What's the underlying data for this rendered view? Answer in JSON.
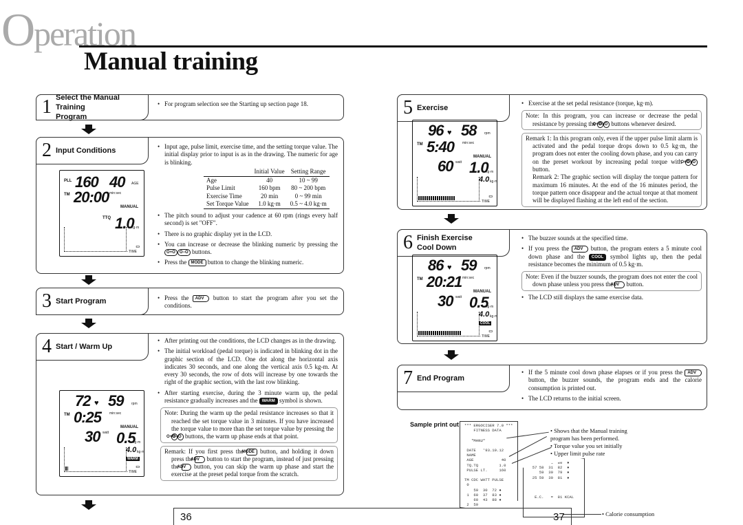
{
  "header": {
    "chapter_first": "O",
    "chapter_rest": "peration",
    "title": "Manual training"
  },
  "sections": {
    "s1": {
      "num": "1",
      "title": [
        "Select the Manual Training",
        "Program"
      ],
      "bullets": [
        [
          {
            "t": "For program selection see the Starting up section page 18."
          }
        ]
      ]
    },
    "s2": {
      "num": "2",
      "title": [
        "Input Conditions"
      ],
      "bullets_top": [
        [
          {
            "t": "Input age, pulse limit, exercise time, and the setting torque value. The initial display prior to input is as in the drawing. The numeric for age is blinking."
          }
        ]
      ],
      "table": {
        "headers": [
          "",
          "Initial Value",
          "Setting Range"
        ],
        "rows": [
          [
            "Age",
            "40",
            "10 ~  99"
          ],
          [
            "Pulse Limit",
            "160 bpm",
            "80 ~ 200 bpm"
          ],
          [
            "Exercise Time",
            "20 min",
            "0 ~  99 min"
          ],
          [
            "Set Torque Value",
            "1.0 kg·m",
            "0.5 ~  4.0 kg·m"
          ]
        ]
      },
      "bullets": [
        [
          {
            "t": "The pitch sound to adjust your cadence at 60 rpm (rings every half second) is set \"OFF\"."
          }
        ],
        [
          {
            "t": "There is no graphic display yet in the LCD."
          }
        ],
        [
          {
            "t": "You can increase or decrease the blinking numeric by pressing the "
          },
          {
            "btn": "plus"
          },
          {
            "btn": "minus"
          },
          {
            "t": " buttons."
          }
        ],
        [
          {
            "t": "Press the "
          },
          {
            "btn": "mode"
          },
          {
            "t": " button to change the blinking numeric."
          }
        ]
      ],
      "lcd": {
        "tl_label": "PLL",
        "a": "160",
        "b": "40",
        "b_unit": "AGE",
        "tm_label": "TM",
        "time": "20:00",
        "time_unit": "min:sec",
        "mode_label": "MANUAL",
        "d_label": "TTQ",
        "d": "1.0",
        "d_unit": "kg·m",
        "axis_label": "TIME"
      }
    },
    "s3": {
      "num": "3",
      "title": [
        "Start Program"
      ],
      "bullets": [
        [
          {
            "t": "Press the "
          },
          {
            "btn": "adv"
          },
          {
            "t": " button to start the program after you set the conditions."
          }
        ]
      ]
    },
    "s4": {
      "num": "4",
      "title": [
        "Start / Warm Up"
      ],
      "bullets": [
        [
          {
            "t": "After printing out the conditions, the LCD changes as in the drawing."
          }
        ],
        [
          {
            "t": "The initial workload (pedal torque) is indicated in blinking dot in the graphic section of the LCD. One dot along the horizontal axis indicates 30 seconds, and one along the vertical axis 0.5 kg-m. At every 30 seconds, the row of dots will increase by one towards the right of the graphic section, with the last row blinking."
          }
        ],
        [
          {
            "t": "After starting exercise, during the 3 minute warm up, the pedal resistance gradually increases and the "
          },
          {
            "btn": "warm"
          },
          {
            "t": " symbol is shown."
          }
        ]
      ],
      "notes": [
        [
          {
            "t": "Note: During the warm up the pedal resistance increases so that it reached the set torque value in 3 minutes. If you have increased the torque value to more than the set torque value by pressing the "
          },
          {
            "btn": "plus"
          },
          {
            "btn": "minus"
          },
          {
            "t": " buttons, the warm up phase ends at that point."
          }
        ],
        [
          {
            "t": "Remark: If you first press the "
          },
          {
            "btn": "mode"
          },
          {
            "t": " button, and holding it down press the "
          },
          {
            "btn": "adv"
          },
          {
            "t": " button to start the program, instead of just pressing the "
          },
          {
            "btn": "adv"
          },
          {
            "t": " button, you can skip the warm up phase and start the exercise at the preset pedal torque from the scratch."
          }
        ]
      ],
      "lcd": {
        "a": "72",
        "heart": "♥",
        "b": "59",
        "b_unit": "rpm",
        "tm_label": "TM",
        "time": "0:25",
        "time_unit": "min:sec",
        "mode_label": "MANUAL",
        "c": "30",
        "c_unit": "watt",
        "d": "0.5",
        "d_unit": "kg·m",
        "e": "4.0",
        "e_unit": "kg·m",
        "badge": "WARM",
        "axis_label": "TIME",
        "bar_fraction": 0.04
      }
    },
    "s5": {
      "num": "5",
      "title": [
        "Exercise"
      ],
      "bullets": [
        [
          {
            "t": "Exercise at the set pedal resistance (torque, kg·m)."
          }
        ]
      ],
      "notes": [
        [
          {
            "t": "Note: In this program, you can increase or decrease the pedal resistance by pressing the "
          },
          {
            "btn": "plus"
          },
          {
            "btn": "minus"
          },
          {
            "t": " buttons whenever desired."
          }
        ],
        [
          {
            "t": "Remark 1: In this program only, even if the upper pulse limit alarm is activated and the pedal torque drops down to 0.5 kg·m, the program does not enter the cooling down phase, and you can carry on the preset workout by increasing pedal torque with "
          },
          {
            "btn": "plus"
          },
          {
            "btn": "minus"
          },
          {
            "t": " button."
          },
          {
            "br": true
          },
          {
            "t": "Remark 2: The graphic section will display the torque pattern for maximum 16 minutes. At the end of the 16 minutes period, the torque pattern once disappear and the actual torque at that moment will be displayed flashing at the left end of the section."
          }
        ]
      ],
      "lcd": {
        "a": "96",
        "heart": "♥",
        "b": "58",
        "b_unit": "rpm",
        "tm_label": "TM",
        "time": "5:40",
        "time_unit": "min:sec",
        "mode_label": "MANUAL",
        "c": "60",
        "c_unit": "watt",
        "d": "1.0",
        "d_unit": "kg·m",
        "e": "4.0",
        "e_unit": "kg·m",
        "axis_label": "TIME",
        "bar_fraction": 0.6
      }
    },
    "s6": {
      "num": "6",
      "title": [
        "Finish Exercise",
        "Cool Down"
      ],
      "bullets": [
        [
          {
            "t": "The buzzer sounds at the specified time."
          }
        ],
        [
          {
            "t": "If you press the "
          },
          {
            "btn": "adv"
          },
          {
            "t": " button, the program enters a 5 minute cool down phase and the "
          },
          {
            "btn": "cool"
          },
          {
            "t": " symbol lights up, then the pedal resistance becomes the minimum of 0.5 kg·m."
          }
        ]
      ],
      "notes": [
        [
          {
            "t": "Note: Even if the buzzer sounds, the program does not enter the cool down phase unless you press the "
          },
          {
            "btn": "adv"
          },
          {
            "t": " button."
          }
        ]
      ],
      "bullets_after": [
        [
          {
            "t": "The LCD still displays the same exercise data."
          }
        ]
      ],
      "lcd": {
        "a": "86",
        "heart": "♥",
        "b": "59",
        "b_unit": "rpm",
        "tm_label": "TM",
        "time": "20:21",
        "time_unit": "min:sec",
        "mode_label": "MANUAL",
        "c": "30",
        "c_unit": "watt",
        "d": "0.5",
        "d_unit": "kg·m",
        "e": "4.0",
        "e_unit": "kg·m",
        "badge": "COOL",
        "axis_label": "TIME",
        "bar_fraction": 0.7
      }
    },
    "s7": {
      "num": "7",
      "title": [
        "End Program"
      ],
      "bullets": [
        [
          {
            "t": "If the 5 minute cool down phase elapses or if you press the "
          },
          {
            "btn": "adv"
          },
          {
            "t": " button, the buzzer sounds, the program ends and the calorie consumption is printed out."
          }
        ],
        [
          {
            "t": "The LCD returns to the initial screen."
          }
        ]
      ]
    }
  },
  "buttons": {
    "plus": "O+O",
    "minus": "O−O",
    "mode": "MODE",
    "adv": "ADV",
    "warm": "WARM",
    "cool": "COOL"
  },
  "printout": {
    "label": "Sample print out",
    "receipt1": "*** ERGOCISER 7.0 ***\n    FITNESS DATA\n\n   \"MANU\"\n\n DATE   '93.10.12\n NAME\n AGE            40\n TQ.TQ         1.0\n PULSE LT.     160\n\nTM CDC WATT PULSE\n 0\n    59  30  72 ♦\n 1  60  37  83 ♦\n    60  43  88 ♦\n 2  59",
    "receipt2": "          5  80  ♦\n  57 58  31  82  ♦\n     59  30  79  ♦\n  25 59  30  81  ♦\n\n\n\n   E.C.   =  81 KCAL",
    "annotations": [
      "• Shows that the Manual training program has been performed.",
      "• Torque value you set initially",
      "• Upper limit pulse rate",
      "• Calorie consumption"
    ]
  },
  "pages": {
    "left": "36",
    "right": "37"
  }
}
